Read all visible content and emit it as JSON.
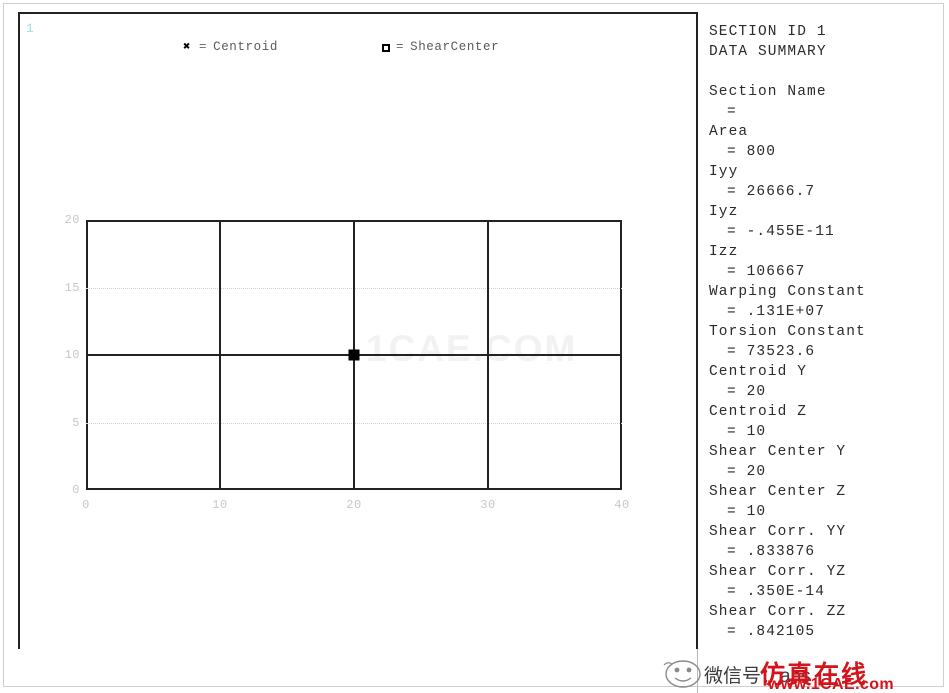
{
  "window": {
    "number_tag": "1",
    "number_color": "#9fe0dd"
  },
  "legend": {
    "entries": [
      {
        "marker": "x-marker-icon",
        "glyph": "✖",
        "equals": "=",
        "label": "Centroid"
      },
      {
        "marker": "square-marker-icon",
        "glyph": "",
        "equals": "=",
        "label": "ShearCenter"
      }
    ]
  },
  "plot": {
    "watermark": "1CAE.COM",
    "marker_name": "centroid-shear-center-marker"
  },
  "chart_data": {
    "type": "mesh",
    "title": "",
    "xlabel": "",
    "ylabel": "",
    "xlim": [
      0,
      40
    ],
    "ylim": [
      0,
      20
    ],
    "xticks": [
      "0",
      "10",
      "20",
      "30",
      "40"
    ],
    "xtick_values": [
      0,
      10,
      20,
      30,
      40
    ],
    "yticks": [
      "0",
      "5",
      "10",
      "15",
      "20"
    ],
    "ytick_values": [
      0,
      5,
      10,
      15,
      20
    ],
    "grid": "dotted at y=5 and y=15",
    "mesh_vertical_lines": [
      0,
      10,
      20,
      30,
      40
    ],
    "mesh_horizontal_lines": [
      0,
      10,
      20
    ],
    "cells_x": 4,
    "cells_y": 2,
    "markers": [
      {
        "label": "Centroid",
        "x": 20,
        "y": 10
      },
      {
        "label": "ShearCenter",
        "x": 20,
        "y": 10
      }
    ]
  },
  "summary": {
    "header": [
      "SECTION ID 1",
      "DATA SUMMARY"
    ],
    "rows": [
      {
        "key": "Section Name",
        "value": "="
      },
      {
        "key": "Area",
        "value": "= 800"
      },
      {
        "key": "Iyy",
        "value": "= 26666.7"
      },
      {
        "key": "Iyz",
        "value": "= -.455E-11"
      },
      {
        "key": "Izz",
        "value": "= 106667"
      },
      {
        "key": "Warping Constant",
        "value": "= .131E+07"
      },
      {
        "key": "Torsion Constant",
        "value": "= 73523.6"
      },
      {
        "key": "Centroid Y",
        "value": "= 20"
      },
      {
        "key": "Centroid Z",
        "value": "= 10"
      },
      {
        "key": "Shear Center Y",
        "value": "= 20"
      },
      {
        "key": "Shear Center Z",
        "value": "= 10"
      },
      {
        "key": "Shear Corr. YY",
        "value": "= .833876"
      },
      {
        "key": "Shear Corr. YZ",
        "value": "= .350E-14"
      },
      {
        "key": "Shear Corr. ZZ",
        "value": "= .842105"
      }
    ]
  },
  "watermark": {
    "wechat_text": "微信号：ans",
    "red_text": "仿真在线",
    "url": "www.1CAE.com",
    "red_color": "#d4131a"
  }
}
